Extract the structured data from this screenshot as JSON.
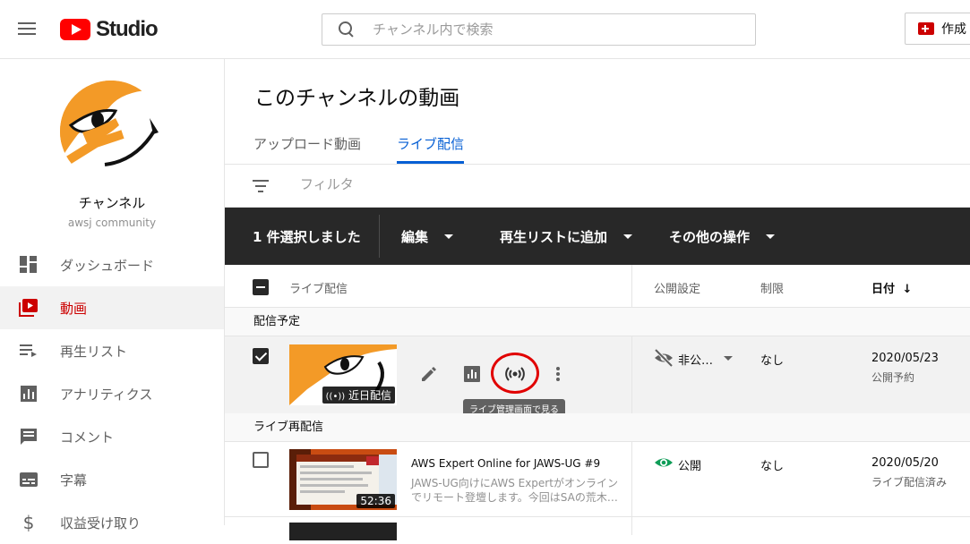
{
  "header": {
    "logo_text": "Studio",
    "search_placeholder": "チャンネル内で検索",
    "create_label": "作成"
  },
  "sidebar": {
    "channel_name": "チャンネル",
    "channel_sub": "awsj community",
    "items": [
      {
        "label": "ダッシュボード",
        "icon": "dashboard-icon",
        "active": false
      },
      {
        "label": "動画",
        "icon": "video-icon",
        "active": true
      },
      {
        "label": "再生リスト",
        "icon": "playlist-icon",
        "active": false
      },
      {
        "label": "アナリティクス",
        "icon": "analytics-icon",
        "active": false
      },
      {
        "label": "コメント",
        "icon": "comment-icon",
        "active": false
      },
      {
        "label": "字幕",
        "icon": "subtitles-icon",
        "active": false
      },
      {
        "label": "収益受け取り",
        "icon": "dollar-icon",
        "active": false
      }
    ]
  },
  "main": {
    "title": "このチャンネルの動画",
    "tabs": [
      {
        "label": "アップロード動画",
        "active": false
      },
      {
        "label": "ライブ配信",
        "active": true
      }
    ],
    "filter_placeholder": "フィルタ",
    "action_bar": {
      "selected_text": "1 件選択しました",
      "edit": "編集",
      "add_playlist": "再生リストに追加",
      "more_actions": "その他の操作"
    },
    "columns": {
      "video": "ライブ配信",
      "visibility": "公開設定",
      "restrictions": "制限",
      "date": "日付"
    },
    "sections": [
      {
        "label": "配信予定",
        "rows": [
          {
            "selected": true,
            "thumb_badge": "近日配信",
            "visibility": "非公…",
            "restriction": "なし",
            "date": "2020/05/23",
            "date_sub": "公開予約",
            "tooltip": "ライブ管理画面で見る"
          }
        ]
      },
      {
        "label": "ライブ再配信",
        "rows": [
          {
            "selected": false,
            "title": "AWS Expert Online for JAWS-UG #9",
            "desc_line1": "JAWS-UG向けにAWS Expertがオンライン",
            "desc_line2": "でリモート登壇します。今回はSAの荒木…",
            "thumb_badge": "52:36",
            "visibility": "公開",
            "restriction": "なし",
            "date": "2020/05/20",
            "date_sub": "ライブ配信済み"
          }
        ]
      }
    ]
  },
  "colors": {
    "brand_red": "#ff0000",
    "active_red": "#cc0000",
    "link_blue": "#065fd4",
    "action_bar": "#282828",
    "annotation_red": "#e10000",
    "public_green": "#0f9d58"
  }
}
